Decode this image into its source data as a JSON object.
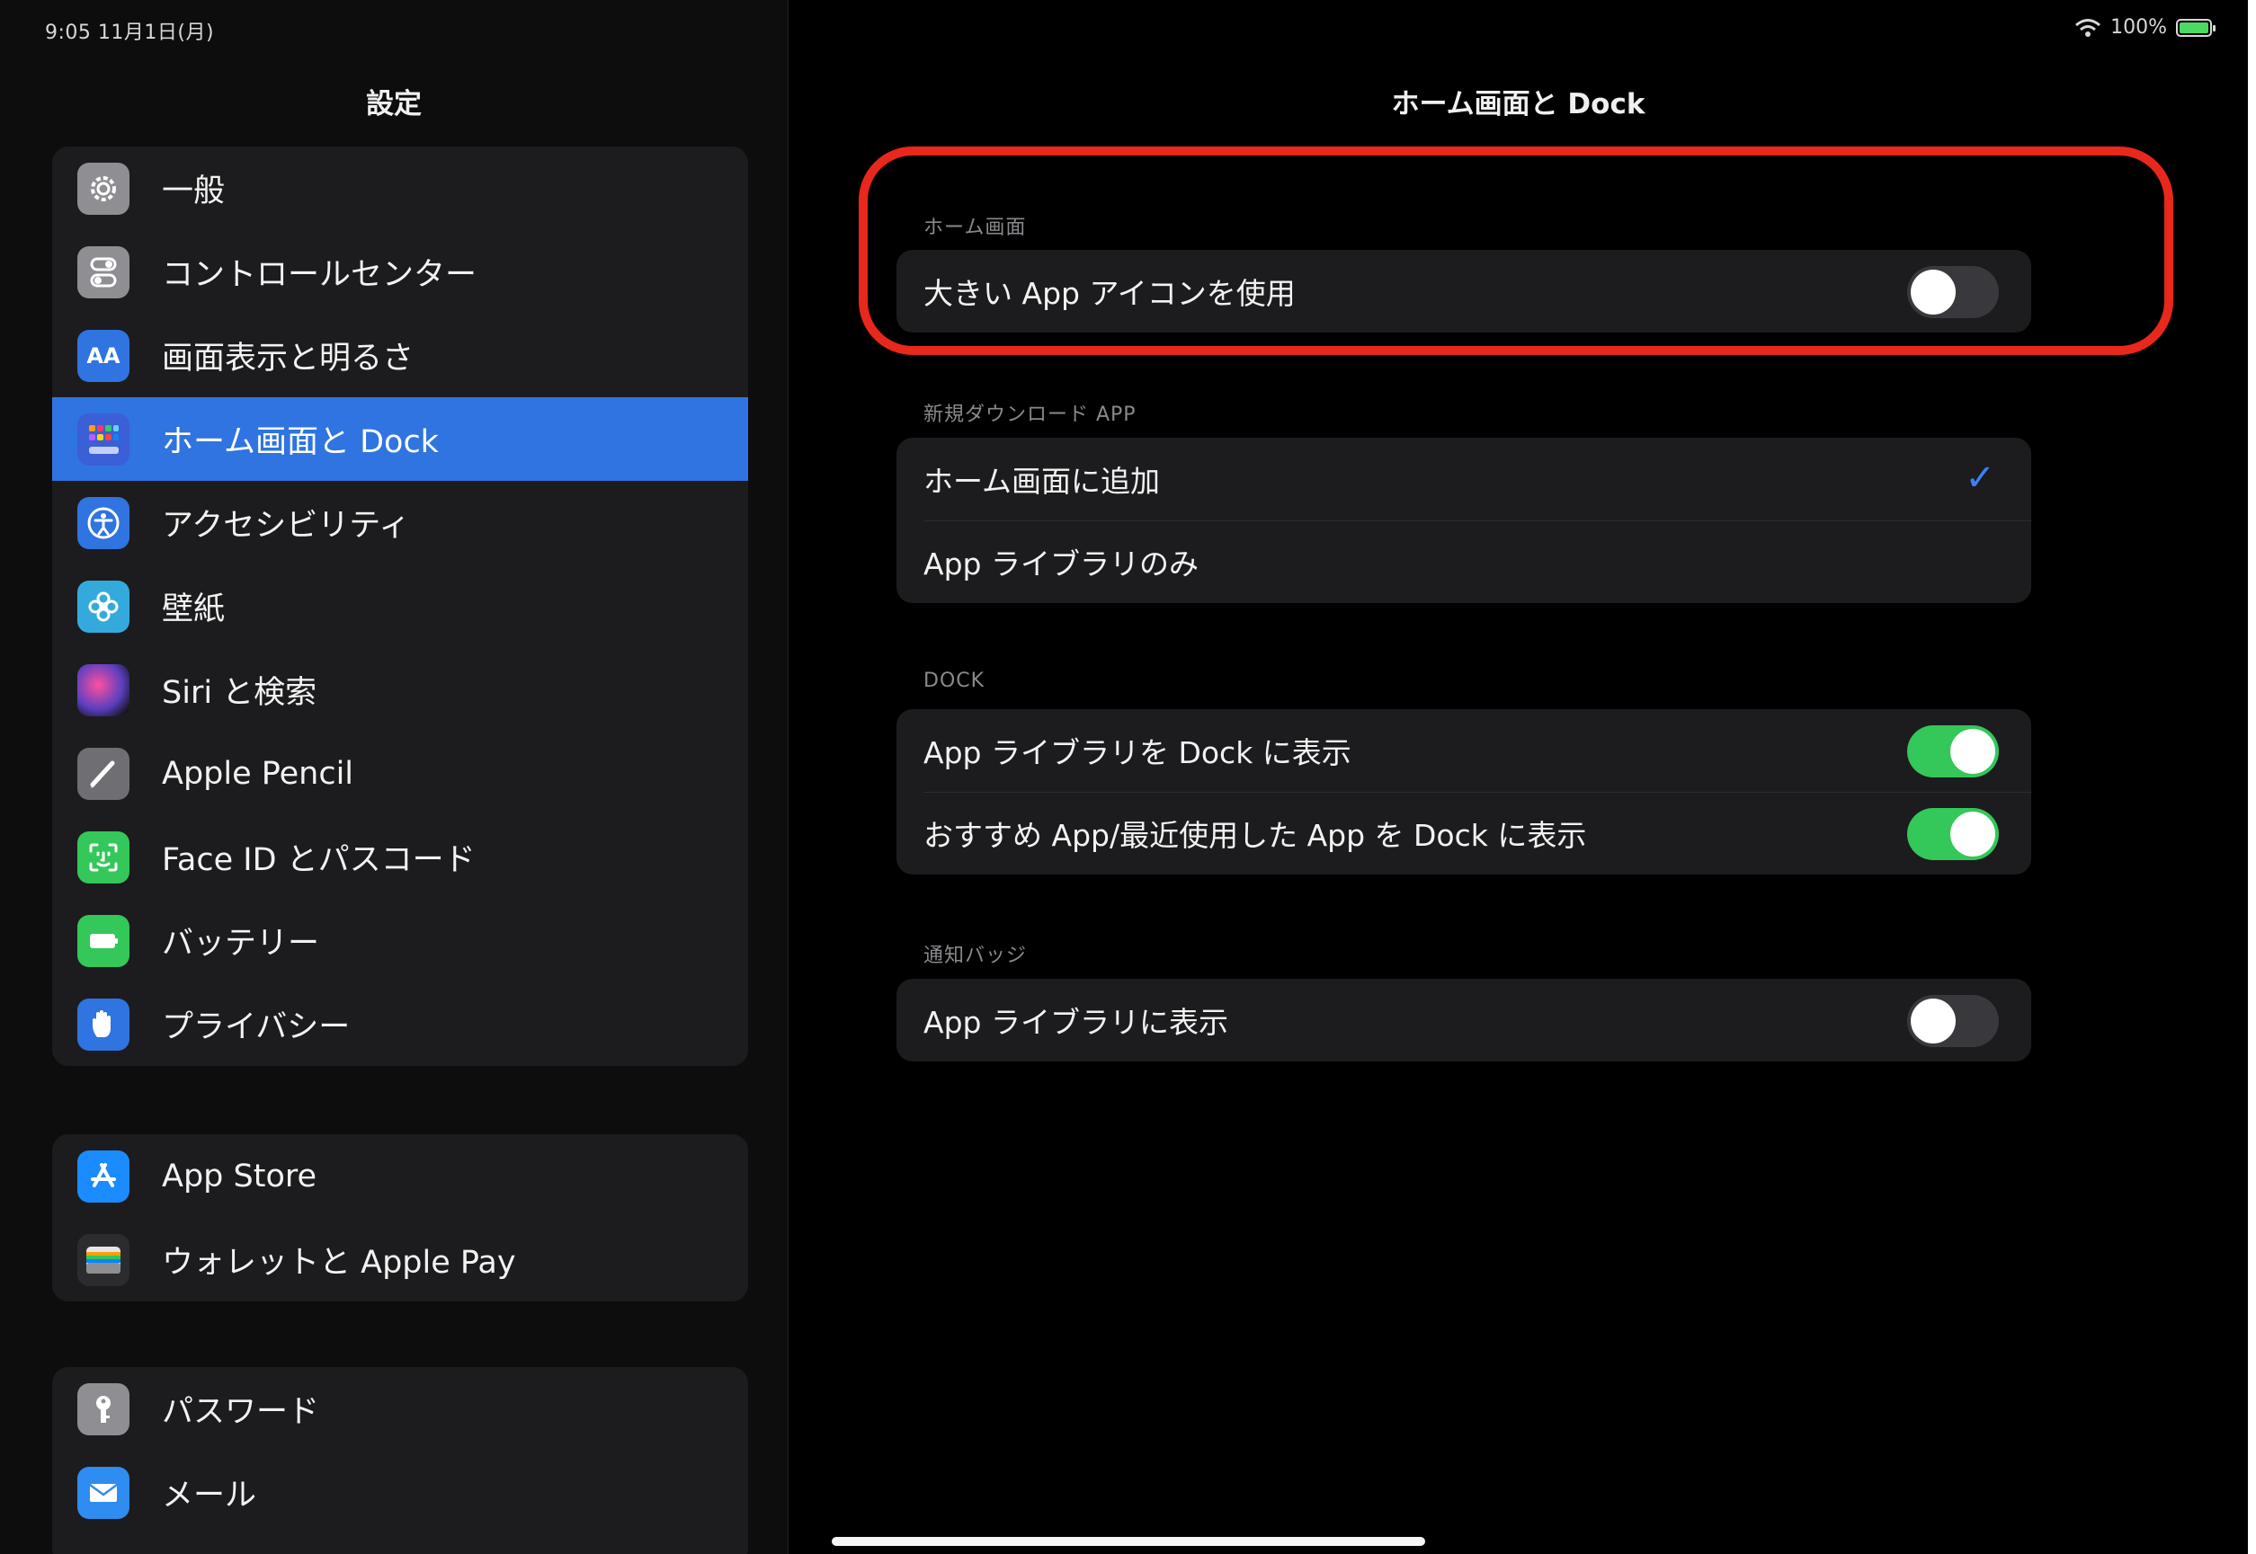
{
  "status_bar": {
    "time_date": "9:05  11月1日(月)",
    "battery_percent": "100%"
  },
  "sidebar": {
    "title": "設定",
    "groups": [
      [
        {
          "label": "一般",
          "icon": "gear-icon",
          "color": "#8e8e93"
        },
        {
          "label": "コントロールセンター",
          "icon": "toggles-icon",
          "color": "#8e8e93"
        },
        {
          "label": "画面表示と明るさ",
          "icon": "text-size-icon",
          "color": "#2f74e0"
        },
        {
          "label": "ホーム画面と Dock",
          "icon": "app-grid-icon",
          "color": "#3a5fd6",
          "selected": true
        },
        {
          "label": "アクセシビリティ",
          "icon": "accessibility-icon",
          "color": "#2f74e0"
        },
        {
          "label": "壁紙",
          "icon": "flower-icon",
          "color": "#34aadc"
        },
        {
          "label": "Siri と検索",
          "icon": "siri-icon",
          "color": "#5a3fc0"
        },
        {
          "label": "Apple Pencil",
          "icon": "pencil-icon",
          "color": "#6e6e73"
        },
        {
          "label": "Face ID とパスコード",
          "icon": "face-id-icon",
          "color": "#34c759"
        },
        {
          "label": "バッテリー",
          "icon": "battery-icon",
          "color": "#34c759"
        },
        {
          "label": "プライバシー",
          "icon": "hand-icon",
          "color": "#2f74e0"
        }
      ],
      [
        {
          "label": "App Store",
          "icon": "app-store-icon",
          "color": "#1a8cff"
        },
        {
          "label": "ウォレットと Apple Pay",
          "icon": "wallet-icon",
          "color": "#2c2c2e"
        }
      ],
      [
        {
          "label": "パスワード",
          "icon": "key-icon",
          "color": "#8e8e93"
        },
        {
          "label": "メール",
          "icon": "mail-icon",
          "color": "#2f8cf0"
        }
      ]
    ]
  },
  "detail": {
    "title": "ホーム画面と Dock",
    "sections": [
      {
        "header": "ホーム画面",
        "rows": [
          {
            "label": "大きい App アイコンを使用",
            "control": "toggle",
            "on": false
          }
        ]
      },
      {
        "header": "新規ダウンロード APP",
        "rows": [
          {
            "label": "ホーム画面に追加",
            "control": "check",
            "checked": true
          },
          {
            "label": "App ライブラリのみ",
            "control": "none"
          }
        ]
      },
      {
        "header": "DOCK",
        "rows": [
          {
            "label": "App ライブラリを Dock に表示",
            "control": "toggle",
            "on": true
          },
          {
            "label": "おすすめ App/最近使用した App を Dock に表示",
            "control": "toggle",
            "on": true
          }
        ]
      },
      {
        "header": "通知バッジ",
        "rows": [
          {
            "label": "App ライブラリに表示",
            "control": "toggle",
            "on": false
          }
        ]
      }
    ]
  }
}
